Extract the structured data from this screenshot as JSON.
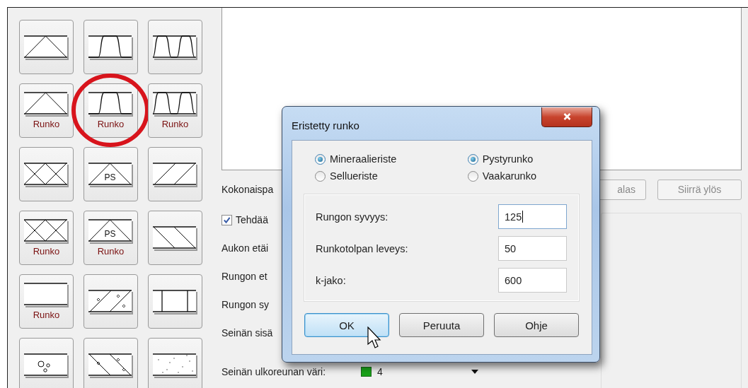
{
  "tiles": [
    {
      "kind": "triangle",
      "highlighted": false
    },
    {
      "kind": "one-bump",
      "highlighted": false
    },
    {
      "kind": "two-bumps",
      "highlighted": false
    },
    {
      "kind": "triangle",
      "label": "Runko",
      "highlighted": false
    },
    {
      "kind": "one-bump",
      "label": "Runko",
      "highlighted": true
    },
    {
      "kind": "two-bumps",
      "label": "Runko",
      "highlighted": false
    },
    {
      "kind": "double-cross",
      "highlighted": false
    },
    {
      "kind": "ps-triangle",
      "text": "PS",
      "highlighted": false
    },
    {
      "kind": "slashes",
      "highlighted": false
    },
    {
      "kind": "double-cross",
      "label": "Runko",
      "highlighted": false
    },
    {
      "kind": "ps-triangle",
      "text": "PS",
      "label": "Runko",
      "highlighted": false
    },
    {
      "kind": "backslashes",
      "highlighted": false
    },
    {
      "kind": "empty",
      "label": "Runko",
      "highlighted": false
    },
    {
      "kind": "slashes-dots",
      "highlighted": false
    },
    {
      "kind": "posts",
      "highlighted": false
    },
    {
      "kind": "circles",
      "highlighted": false
    },
    {
      "kind": "backslashes-dots",
      "highlighted": false
    },
    {
      "kind": "dots",
      "highlighted": false
    }
  ],
  "form": {
    "total_label": "Kokonaispa",
    "move_buttons": [
      {
        "label": "alas",
        "disabled": true
      },
      {
        "label": "Siirrä ylös",
        "disabled": true
      }
    ],
    "checkbox": {
      "label": "Tehdää",
      "checked": true
    },
    "labels": [
      "Aukon etäi",
      "Rungon et",
      "Rungon sy",
      "Seinän sisä"
    ],
    "color_field": {
      "label": "Seinän ulkoreunan väri:",
      "value": "4",
      "color": "#1aa31a"
    }
  },
  "dialog": {
    "title": "Eristetty runko",
    "radio_groups": [
      [
        {
          "label": "Mineraalieriste",
          "selected": true
        },
        {
          "label": "Sellueriste",
          "selected": false
        }
      ],
      [
        {
          "label": "Pystyrunko",
          "selected": true
        },
        {
          "label": "Vaakarunko",
          "selected": false
        }
      ]
    ],
    "fields": [
      {
        "label": "Rungon syvyys:",
        "value": "125",
        "focused": true
      },
      {
        "label": "Runkotolpan leveys:",
        "value": "50",
        "focused": false
      },
      {
        "label": "k-jako:",
        "value": "600",
        "focused": false
      }
    ],
    "buttons": [
      {
        "label": "OK",
        "default": true
      },
      {
        "label": "Peruuta",
        "default": false
      },
      {
        "label": "Ohje",
        "default": false
      }
    ]
  }
}
